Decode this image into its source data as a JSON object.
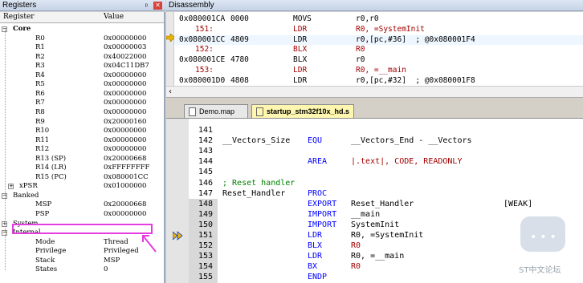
{
  "registers_pane": {
    "title": "Registers",
    "pin": "ᵖ",
    "close": "✕",
    "col_register": "Register",
    "col_value": "Value",
    "rows": [
      {
        "name": "Core",
        "value": "",
        "level": 0,
        "toggle": "−",
        "bold": true
      },
      {
        "name": "R0",
        "value": "0x00000000",
        "level": 2
      },
      {
        "name": "R1",
        "value": "0x00000003",
        "level": 2
      },
      {
        "name": "R2",
        "value": "0x40022000",
        "level": 2
      },
      {
        "name": "R3",
        "value": "0x04C11DB7",
        "level": 2
      },
      {
        "name": "R4",
        "value": "0x00000000",
        "level": 2
      },
      {
        "name": "R5",
        "value": "0x00000000",
        "level": 2
      },
      {
        "name": "R6",
        "value": "0x00000000",
        "level": 2
      },
      {
        "name": "R7",
        "value": "0x00000000",
        "level": 2
      },
      {
        "name": "R8",
        "value": "0x00000000",
        "level": 2
      },
      {
        "name": "R9",
        "value": "0x20000160",
        "level": 2
      },
      {
        "name": "R10",
        "value": "0x00000000",
        "level": 2
      },
      {
        "name": "R11",
        "value": "0x00000000",
        "level": 2
      },
      {
        "name": "R12",
        "value": "0x00000000",
        "level": 2
      },
      {
        "name": "R13 (SP)",
        "value": "0x20000668",
        "level": 2
      },
      {
        "name": "R14 (LR)",
        "value": "0xFFFFFFFF",
        "level": 2
      },
      {
        "name": "R15 (PC)",
        "value": "0x080001CC",
        "level": 2
      },
      {
        "name": "xPSR",
        "value": "0x01000000",
        "level": 1,
        "toggle": "+"
      },
      {
        "name": "Banked",
        "value": "",
        "level": 0,
        "toggle": "−"
      },
      {
        "name": "MSP",
        "value": "0x20000668",
        "level": 2
      },
      {
        "name": "PSP",
        "value": "0x00000000",
        "level": 2
      },
      {
        "name": "System",
        "value": "",
        "level": 0,
        "toggle": "+"
      },
      {
        "name": "Internal",
        "value": "",
        "level": 0,
        "toggle": "−"
      },
      {
        "name": "Mode",
        "value": "Thread",
        "level": 2
      },
      {
        "name": "Privilege",
        "value": "Privileged",
        "level": 2
      },
      {
        "name": "Stack",
        "value": "MSP",
        "level": 2
      },
      {
        "name": "States",
        "value": "0",
        "level": 2
      }
    ]
  },
  "disassembly": {
    "title": "Disassembly",
    "scroll_left": "‹",
    "lines": [
      {
        "kind": "asm",
        "addr": "0x080001CA",
        "hex": "0000",
        "mn": "MOVS",
        "op": "r0,r0"
      },
      {
        "kind": "src",
        "ln": "151:",
        "mn": "LDR",
        "op": "R0, =SystemInit"
      },
      {
        "kind": "asm",
        "addr": "0x080001CC",
        "hex": "4809",
        "mn": "LDR",
        "op": "r0,[pc,#36]  ; @0x080001F4",
        "cur": true
      },
      {
        "kind": "src",
        "ln": "152:",
        "mn": "BLX",
        "op": "R0"
      },
      {
        "kind": "asm",
        "addr": "0x080001CE",
        "hex": "4780",
        "mn": "BLX",
        "op": "r0"
      },
      {
        "kind": "src",
        "ln": "153:",
        "mn": "LDR",
        "op": "R0, =__main"
      },
      {
        "kind": "asm",
        "addr": "0x080001D0",
        "hex": "4808",
        "mn": "LDR",
        "op": "r0,[pc,#32]  ; @0x080001F8"
      }
    ]
  },
  "tabs": [
    {
      "label": "Demo.map"
    },
    {
      "label": "startup_stm32f10x_hd.s",
      "active": true
    }
  ],
  "editor": {
    "lines": [
      {
        "n": "141"
      },
      {
        "n": "142",
        "lb": "__Vectors_Size",
        "kw": "EQU",
        "ar": "__Vectors_End - __Vectors"
      },
      {
        "n": "143"
      },
      {
        "n": "144",
        "kw": "AREA",
        "ar": "|.text|, CODE, READONLY",
        "arcolor": "red"
      },
      {
        "n": "145"
      },
      {
        "n": "146",
        "cm": "; Reset handler"
      },
      {
        "n": "147",
        "lb": "Reset_Handler",
        "kw": "PROC"
      },
      {
        "n": "148",
        "kw": "EXPORT",
        "ar": "Reset_Handler",
        "rt": "[WEAK]"
      },
      {
        "n": "149",
        "kw": "IMPORT",
        "ar": "__main"
      },
      {
        "n": "150",
        "kw": "IMPORT",
        "ar": "SystemInit"
      },
      {
        "n": "151",
        "kw": "LDR",
        "ar": "R0, =SystemInit",
        "exec": true
      },
      {
        "n": "152",
        "kw": "BLX",
        "ar": "R0",
        "arcolor": "red"
      },
      {
        "n": "153",
        "kw": "LDR",
        "ar": "R0, =__main"
      },
      {
        "n": "154",
        "kw": "BX",
        "ar": "R0",
        "arcolor": "red"
      },
      {
        "n": "155",
        "kw": "ENDP"
      }
    ]
  },
  "watermark": {
    "text": "ST中文论坛"
  }
}
